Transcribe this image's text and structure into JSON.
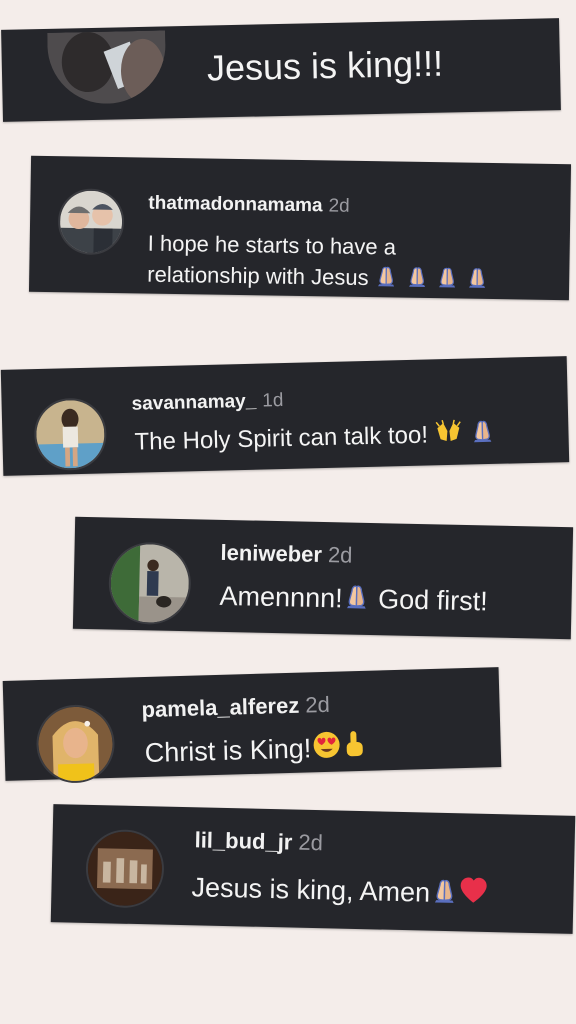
{
  "comments": [
    {
      "username": "",
      "time": "",
      "text": "Jesus is king!!!",
      "emoji": [],
      "avatar": "avatar-man-with-child"
    },
    {
      "username": "thatmadonnamama",
      "time": "2d",
      "text_lines": [
        "I hope he starts to have a",
        "relationship with Jesus"
      ],
      "emoji": [
        "folded-hands-icon",
        "folded-hands-icon",
        "folded-hands-icon",
        "folded-hands-icon"
      ],
      "avatar": "avatar-couple"
    },
    {
      "username": "savannamay_",
      "time": "1d",
      "text": "The Holy Spirit can talk too!",
      "emoji": [
        "raising-hands-icon",
        "folded-hands-icon"
      ],
      "avatar": "avatar-woman-by-pool"
    },
    {
      "username": "leniweber",
      "time": "2d",
      "text_a": "Amennnn!",
      "text_b": " God first!",
      "emoji": [
        "folded-hands-icon"
      ],
      "avatar": "avatar-person-with-dog"
    },
    {
      "username": "pamela_alferez",
      "time": "2d",
      "text": "Christ is King!",
      "emoji": [
        "heart-eyes-icon",
        "pointing-up-icon"
      ],
      "avatar": "avatar-woman-blonde"
    },
    {
      "username": "lil_bud_jr",
      "time": "2d",
      "text": "Jesus is king, Amen",
      "emoji": [
        "folded-hands-icon",
        "red-heart-icon"
      ],
      "avatar": "avatar-vintage-photo"
    }
  ],
  "colors": {
    "background": "#f4edea",
    "card": "#25262b",
    "username": "#f2f2f2",
    "timestamp": "#9b9ba1",
    "text": "#f4f4f4"
  }
}
